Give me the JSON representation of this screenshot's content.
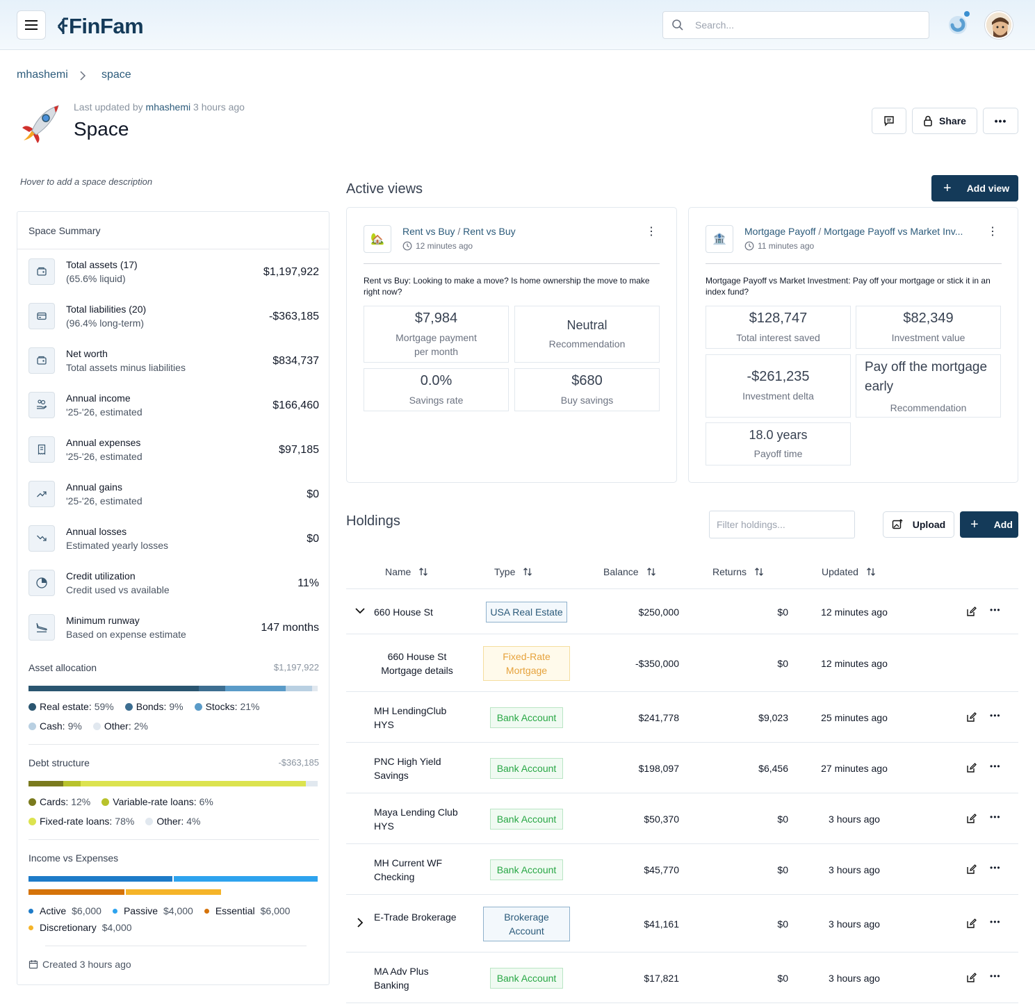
{
  "header": {
    "brand": "FinFam",
    "search_placeholder": "Search..."
  },
  "breadcrumb": [
    "mhashemi",
    "space"
  ],
  "page": {
    "last_updated_prefix": "Last updated by",
    "last_updated_user": "mhashemi",
    "last_updated_time": "3 hours ago",
    "title": "Space",
    "share_label": "Share",
    "description_hint": "Hover to add a space description"
  },
  "summary": {
    "heading": "Space Summary",
    "rows": [
      {
        "label": "Total assets (17)",
        "sub": "(65.6% liquid)",
        "value": "$1,197,922",
        "icon": "wallet-icon"
      },
      {
        "label": "Total liabilities (20)",
        "sub": "(96.4% long-term)",
        "value": "-$363,185",
        "icon": "credit-card-icon"
      },
      {
        "label": "Net worth",
        "sub": "Total assets minus liabilities",
        "value": "$834,737",
        "icon": "wallet-icon"
      },
      {
        "label": "Annual income",
        "sub": "'25-'26, estimated",
        "value": "$166,460",
        "icon": "hand-coins-icon"
      },
      {
        "label": "Annual expenses",
        "sub": "'25-'26, estimated",
        "value": "$97,185",
        "icon": "receipt-icon"
      },
      {
        "label": "Annual gains",
        "sub": "'25-'26, estimated",
        "value": "$0",
        "icon": "trending-up-icon"
      },
      {
        "label": "Annual losses",
        "sub": "Estimated yearly losses",
        "value": "$0",
        "icon": "trending-down-icon"
      },
      {
        "label": "Credit utilization",
        "sub": "Credit used vs available",
        "value": "11%",
        "icon": "pie-chart-icon"
      },
      {
        "label": "Minimum runway",
        "sub": "Based on expense estimate",
        "value": "147 months",
        "icon": "plane-landing-icon"
      }
    ],
    "asset_allocation": {
      "title": "Asset allocation",
      "total": "$1,197,922",
      "items": [
        {
          "name": "Real estate:",
          "pct": "59%",
          "share": 59,
          "color": "#2a5570"
        },
        {
          "name": "Bonds:",
          "pct": "9%",
          "share": 9,
          "color": "#3d6e91"
        },
        {
          "name": "Stocks:",
          "pct": "21%",
          "share": 21,
          "color": "#5a9bc8"
        },
        {
          "name": "Cash:",
          "pct": "9%",
          "share": 9,
          "color": "#b9d0e2"
        },
        {
          "name": "Other:",
          "pct": "2%",
          "share": 2,
          "color": "#e1e8ef"
        }
      ]
    },
    "debt_structure": {
      "title": "Debt structure",
      "total": "-$363,185",
      "items": [
        {
          "name": "Cards:",
          "pct": "12%",
          "share": 12,
          "color": "#7a7a1e"
        },
        {
          "name": "Variable-rate loans:",
          "pct": "6%",
          "share": 6,
          "color": "#b8c22c"
        },
        {
          "name": "Fixed-rate loans:",
          "pct": "78%",
          "share": 78,
          "color": "#dce34f"
        },
        {
          "name": "Other:",
          "pct": "4%",
          "share": 4,
          "color": "#e1e8ef"
        }
      ]
    },
    "income_expenses": {
      "title": "Income vs Expenses",
      "items": [
        {
          "name": "Active",
          "amount": "$6,000",
          "color": "#1e7bc8"
        },
        {
          "name": "Passive",
          "amount": "$4,000",
          "color": "#2ea3ee"
        },
        {
          "name": "Essential",
          "amount": "$6,000",
          "color": "#d5730a"
        },
        {
          "name": "Discretionary",
          "amount": "$4,000",
          "color": "#f5b429"
        }
      ]
    },
    "created": "Created 3 hours ago"
  },
  "active_views": {
    "heading": "Active views",
    "add_label": "Add view",
    "cards": [
      {
        "icon": "house-icon",
        "title_a": "Rent vs Buy",
        "title_b": "Rent vs Buy",
        "time": "12 minutes ago",
        "description": "Rent vs Buy: Looking to make a move? Is home ownership the move to make right now?",
        "metrics": [
          {
            "value": "$7,984",
            "label": "Mortgage payment per month"
          },
          {
            "value": "Neutral",
            "label": "Recommendation"
          },
          {
            "value": "0.0%",
            "label": "Savings rate"
          },
          {
            "value": "$680",
            "label": "Buy savings"
          }
        ]
      },
      {
        "icon": "bank-icon",
        "title_a": "Mortgage Payoff",
        "title_b": "Mortgage Payoff vs Market Inv...",
        "time": "11 minutes ago",
        "description": "Mortgage Payoff vs Market Investment: Pay off your mortgage or stick it in an index fund?",
        "metrics": [
          {
            "value": "$128,747",
            "label": "Total interest saved"
          },
          {
            "value": "$82,349",
            "label": "Investment value"
          },
          {
            "value": "-$261,235",
            "label": "Investment delta"
          },
          {
            "value": "Pay off the mortgage early",
            "label": "Recommendation"
          },
          {
            "value": "18.0 years",
            "label": "Payoff time"
          }
        ]
      }
    ]
  },
  "holdings": {
    "heading": "Holdings",
    "filter_placeholder": "Filter holdings...",
    "upload_label": "Upload",
    "add_label": "Add",
    "columns": [
      "Name",
      "Type",
      "Balance",
      "Returns",
      "Updated"
    ],
    "rows": [
      {
        "name": "660 House St",
        "type": "USA Real Estate",
        "badge": "usa",
        "balance": "$250,000",
        "returns": "$0",
        "updated": "12 minutes ago",
        "expander": "down"
      },
      {
        "name": "660 House St Mortgage details",
        "type": "Fixed-Rate Mortgage",
        "badge": "fixed",
        "balance": "-$350,000",
        "returns": "$0",
        "updated": "12 minutes ago",
        "expander": "",
        "child": true
      },
      {
        "name": "MH LendingClub HYS",
        "type": "Bank Account",
        "badge": "bank",
        "balance": "$241,778",
        "returns": "$9,023",
        "updated": "25 minutes ago",
        "expander": ""
      },
      {
        "name": "PNC High Yield Savings",
        "type": "Bank Account",
        "badge": "bank",
        "balance": "$198,097",
        "returns": "$6,456",
        "updated": "27 minutes ago",
        "expander": ""
      },
      {
        "name": "Maya Lending Club HYS",
        "type": "Bank Account",
        "badge": "bank",
        "balance": "$50,370",
        "returns": "$0",
        "updated": "3 hours ago",
        "expander": ""
      },
      {
        "name": "MH Current WF Checking",
        "type": "Bank Account",
        "badge": "bank",
        "balance": "$45,770",
        "returns": "$0",
        "updated": "3 hours ago",
        "expander": ""
      },
      {
        "name": "E-Trade Brokerage",
        "type": "Brokerage Account",
        "badge": "broker",
        "balance": "$41,161",
        "returns": "$0",
        "updated": "3 hours ago",
        "expander": "right"
      },
      {
        "name": "MA Adv Plus Banking",
        "type": "Bank Account",
        "badge": "bank",
        "balance": "$17,821",
        "returns": "$0",
        "updated": "3 hours ago",
        "expander": ""
      }
    ]
  }
}
